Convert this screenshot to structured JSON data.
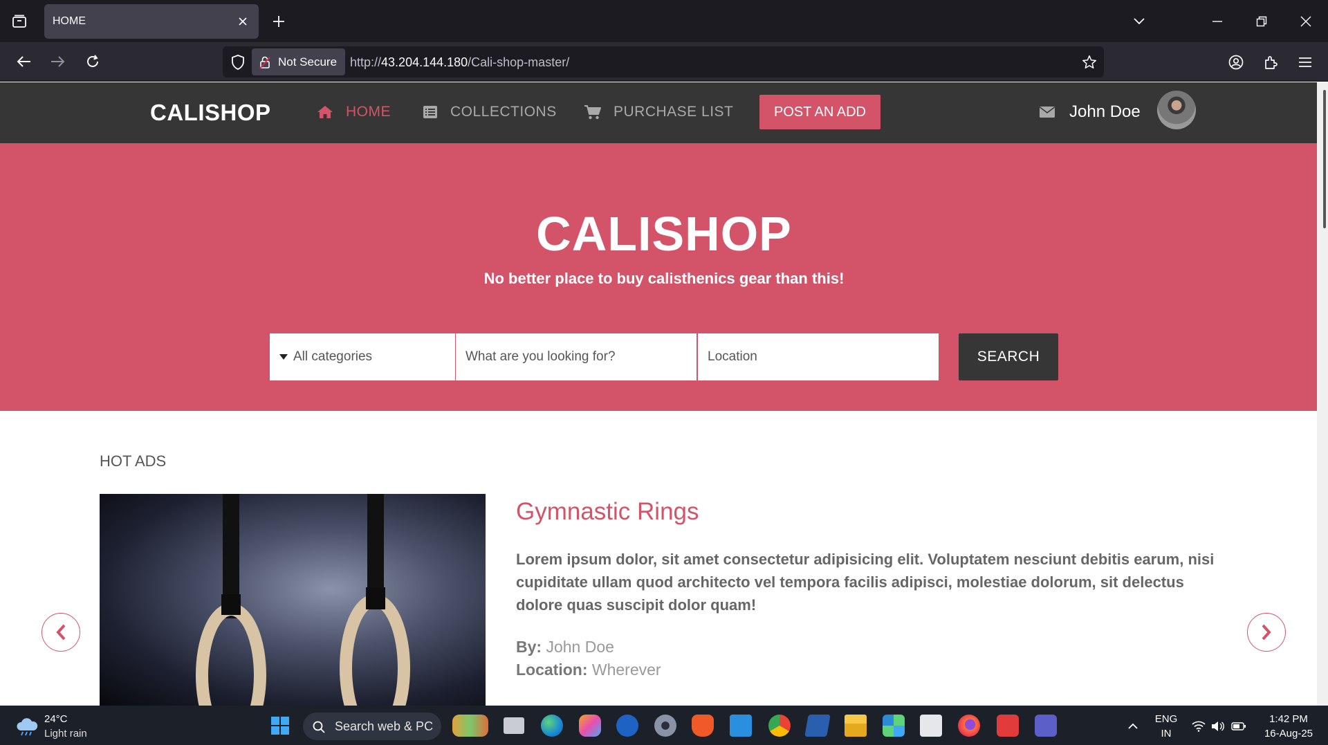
{
  "browser": {
    "tab_title": "HOME",
    "security_label": "Not Secure",
    "url_prefix": "http://",
    "url_host": "43.204.144.180",
    "url_path": "/Cali-shop-master/"
  },
  "site": {
    "brand": "CALISHOP",
    "nav": {
      "home": "HOME",
      "collections": "COLLECTIONS",
      "purchase_list": "PURCHASE LIST",
      "post_ad": "POST AN ADD"
    },
    "user_name": "John Doe",
    "accent_color": "#d35468"
  },
  "hero": {
    "title": "CALISHOP",
    "subtitle": "No better place to buy calisthenics gear than this!",
    "category_select": "All categories",
    "query_placeholder": "What are you looking for?",
    "location_placeholder": "Location",
    "search_button": "SEARCH"
  },
  "hot_ads": {
    "heading": "HOT ADS",
    "item": {
      "title": "Gymnastic Rings",
      "description": "Lorem ipsum dolor, sit amet consectetur adipisicing elit. Voluptatem nesciunt debitis earum, nisi cupiditate ullam quod architecto vel tempora facilis adipisci, molestiae dolorum, sit delectus dolore quas suscipit dolor quam!",
      "by_label": "By:",
      "by_value": "John Doe",
      "location_label": "Location:",
      "location_value": "Wherever"
    }
  },
  "taskbar": {
    "temperature": "24°C",
    "weather": "Light rain",
    "search_text": "Search web & PC",
    "lang_top": "ENG",
    "lang_bottom": "IN",
    "time": "1:42 PM",
    "date": "16-Aug-25"
  }
}
